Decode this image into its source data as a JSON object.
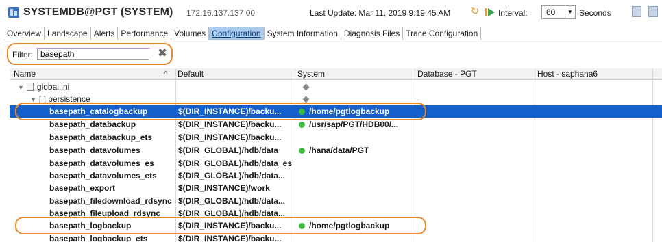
{
  "header": {
    "title": "SYSTEMDB@PGT (SYSTEM)",
    "host": "172.16.137.137 00",
    "last_update": "Last Update:  Mar 11, 2019 9:19:45 AM",
    "interval_label": "Interval:",
    "interval_value": "60",
    "seconds_label": "Seconds"
  },
  "tabs": [
    {
      "label": "Overview"
    },
    {
      "label": "Landscape"
    },
    {
      "label": "Alerts"
    },
    {
      "label": "Performance"
    },
    {
      "label": "Volumes"
    },
    {
      "label": "Configuration",
      "active": true
    },
    {
      "label": "System Information"
    },
    {
      "label": "Diagnosis Files"
    },
    {
      "label": "Trace Configuration"
    }
  ],
  "filter": {
    "label": "Filter:",
    "value": "basepath"
  },
  "table": {
    "columns": [
      "Name",
      "Default",
      "System",
      "Database - PGT",
      "Host - saphana6"
    ],
    "sort_indicator": "^",
    "tree": {
      "file": "global.ini",
      "section": "[ ] persistence"
    },
    "rows": [
      {
        "name": "basepath_catalogbackup",
        "default": "$(DIR_INSTANCE)/backu...",
        "system": "/home/pgtlogbackup",
        "selected": true
      },
      {
        "name": "basepath_databackup",
        "default": "$(DIR_INSTANCE)/backu...",
        "system": "/usr/sap/PGT/HDB00/..."
      },
      {
        "name": "basepath_databackup_ets",
        "default": "$(DIR_INSTANCE)/backu...",
        "system": ""
      },
      {
        "name": "basepath_datavolumes",
        "default": "$(DIR_GLOBAL)/hdb/data",
        "system": "/hana/data/PGT"
      },
      {
        "name": "basepath_datavolumes_es",
        "default": "$(DIR_GLOBAL)/hdb/data_es",
        "system": ""
      },
      {
        "name": "basepath_datavolumes_ets",
        "default": "$(DIR_GLOBAL)/hdb/data...",
        "system": ""
      },
      {
        "name": "basepath_export",
        "default": "$(DIR_INSTANCE)/work",
        "system": ""
      },
      {
        "name": "basepath_filedownload_rdsync",
        "default": "$(DIR_GLOBAL)/hdb/data...",
        "system": ""
      },
      {
        "name": "basepath_fileupload_rdsync",
        "default": "$(DIR_GLOBAL)/hdb/data...",
        "system": ""
      },
      {
        "name": "basepath_logbackup",
        "default": "$(DIR_INSTANCE)/backu...",
        "system": "/home/pgtlogbackup"
      },
      {
        "name": "basepath_logbackup_ets",
        "default": "$(DIR_INSTANCE)/backu...",
        "system": ""
      }
    ]
  },
  "colors": {
    "highlight": "#e8892a",
    "selection": "#1260cc",
    "status_ok": "#3dbb3d",
    "active_tab": "#aacbee"
  }
}
